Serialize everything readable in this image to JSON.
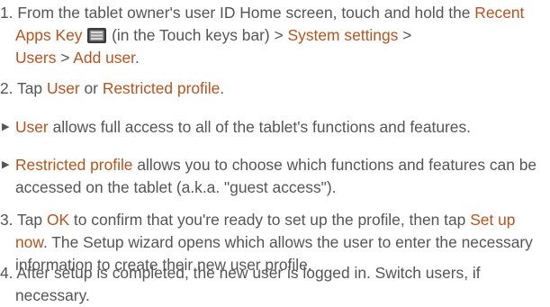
{
  "steps": {
    "step1": {
      "number": "1.",
      "text_a": "From the tablet owner's user ID Home screen, touch and hold the",
      "recent_apps_key": "Recent Apps Key",
      "text_b": "(in the Touch keys bar) >",
      "system_settings": "System settings",
      "sep1": ">",
      "users": "Users",
      "sep2": ">",
      "add_user": "Add user",
      "end": "."
    },
    "step2": {
      "number": "2.",
      "text_a": "Tap",
      "user": "User",
      "or": "or",
      "restricted_profile": "Restricted profile",
      "end": "."
    },
    "bullet1": {
      "marker": "▶",
      "user": "User",
      "text": "allows full access to all of the tablet's functions and features."
    },
    "bullet2": {
      "marker": "▶",
      "restricted_profile": "Restricted profile",
      "text": "allows you to choose which functions and features can be accessed on the tablet (a.k.a. \"guest access\")."
    },
    "step3": {
      "number": "3.",
      "text_a": "Tap",
      "ok": "OK",
      "text_b": "to confirm that you're ready to set up the profile, then tap",
      "set_up_now": "Set up now",
      "text_c": ". The Setup wizard opens which allows the user to enter the necessary information to create their new user profile."
    },
    "step4": {
      "number": "4.",
      "text": "After setup is completed, the new user is logged in. Switch users, if necessary."
    }
  },
  "icons": {
    "recent_apps_key": "recent-apps-key-icon"
  }
}
